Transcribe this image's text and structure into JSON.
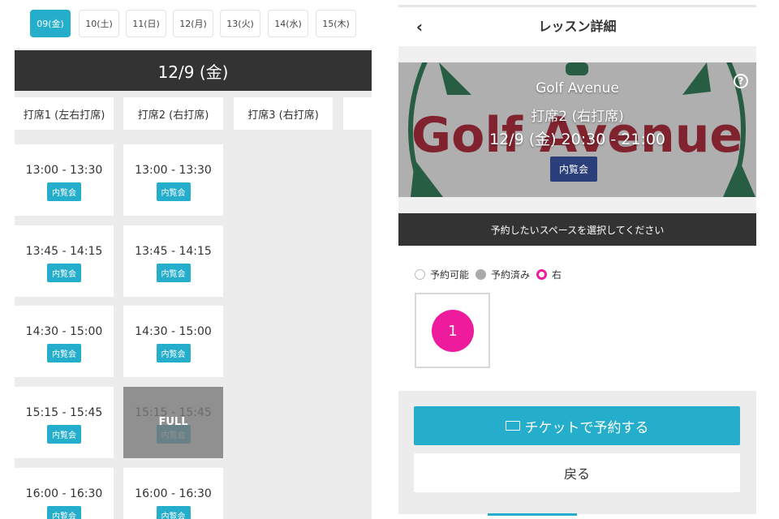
{
  "schedule": {
    "dates": [
      "09(金)",
      "10(土)",
      "11(日)",
      "12(月)",
      "13(火)",
      "14(水)",
      "15(木)"
    ],
    "selected_date_index": 0,
    "date_header": "12/9 (金)",
    "bays": [
      "打席1 (左右打席)",
      "打席2 (右打席)",
      "打席3 (右打席)"
    ],
    "bay1_slots": [
      {
        "time": "13:00 - 13:30",
        "badge": "内覧会"
      },
      {
        "time": "13:45 - 14:15",
        "badge": "内覧会"
      },
      {
        "time": "14:30 - 15:00",
        "badge": "内覧会"
      },
      {
        "time": "15:15 - 15:45",
        "badge": "内覧会"
      },
      {
        "time": "16:00 - 16:30",
        "badge": "内覧会"
      }
    ],
    "bay2_slots": [
      {
        "time": "13:00 - 13:30",
        "badge": "内覧会"
      },
      {
        "time": "13:45 - 14:15",
        "badge": "内覧会"
      },
      {
        "time": "14:30 - 15:00",
        "badge": "内覧会"
      },
      {
        "time": "15:15 - 15:45",
        "badge": "内覧会",
        "full_label": "FULL"
      },
      {
        "time": "16:00 - 16:30",
        "badge": "内覧会"
      }
    ]
  },
  "detail": {
    "title": "レッスン詳細",
    "back_icon": "‹",
    "banner": {
      "logo_text": "Golf Avenue",
      "venue": "Golf Avenue",
      "seat": "打席2 (右打席)",
      "time": "12/9 (金) 20:30 - 21:00",
      "badge": "内覧会",
      "help": "?"
    },
    "select_prompt": "予約したいスペースを選択してください",
    "legend": {
      "available": "予約可能",
      "booked": "予約済み",
      "right": "右"
    },
    "seat_number": "1",
    "ticket_button": "チケットで予約する",
    "back_button": "戻る"
  },
  "colors": {
    "accent": "#25aecb",
    "seat_pink": "#ee1c9c",
    "dark_bar": "#333333",
    "badge_navy": "#2b3f7a",
    "logo_red": "#a3182a",
    "logo_green": "#1e6e46"
  }
}
